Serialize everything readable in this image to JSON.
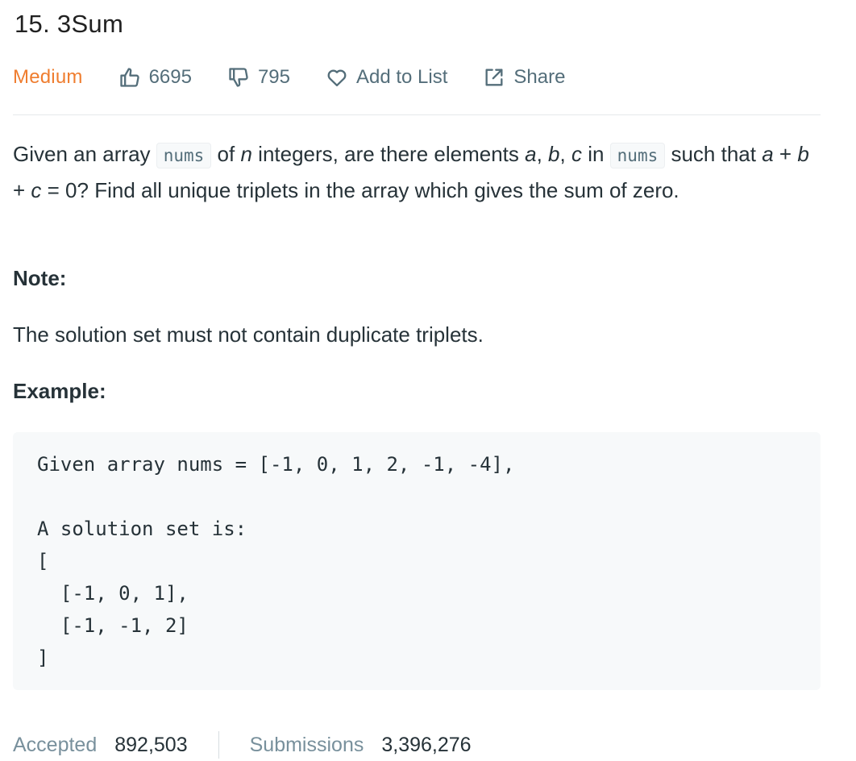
{
  "problem": {
    "title": "15. 3Sum",
    "difficulty": "Medium",
    "likes": "6695",
    "dislikes": "795",
    "add_to_list_label": "Add to List",
    "share_label": "Share"
  },
  "description": {
    "part1": "Given an array ",
    "code1": "nums",
    "part2": " of ",
    "var_n": "n",
    "part3": " integers, are there elements ",
    "var_a": "a",
    "comma1": ", ",
    "var_b": "b",
    "comma2": ", ",
    "var_c": "c",
    "part4": " in ",
    "code2": "nums",
    "part5": " such that ",
    "eq_a": "a",
    "plus1": " + ",
    "eq_b": "b",
    "plus2": " + ",
    "eq_c": "c",
    "part6": " = 0? Find all unique triplets in the array which gives the sum of zero."
  },
  "note": {
    "label": "Note:",
    "text": "The solution set must not contain duplicate triplets."
  },
  "example": {
    "label": "Example:",
    "code": "Given array nums = [-1, 0, 1, 2, -1, -4],\n\nA solution set is:\n[\n  [-1, 0, 1],\n  [-1, -1, 2]\n]"
  },
  "stats": {
    "accepted_label": "Accepted",
    "accepted_value": "892,503",
    "submissions_label": "Submissions",
    "submissions_value": "3,396,276"
  },
  "colors": {
    "difficulty_medium": "#ef7d2f",
    "text_primary": "#263238",
    "text_muted": "#546e7a",
    "code_bg": "#f7f9fa"
  },
  "icons": {
    "like": "thumbs-up-icon",
    "dislike": "thumbs-down-icon",
    "favorite": "heart-icon",
    "share": "share-icon"
  }
}
